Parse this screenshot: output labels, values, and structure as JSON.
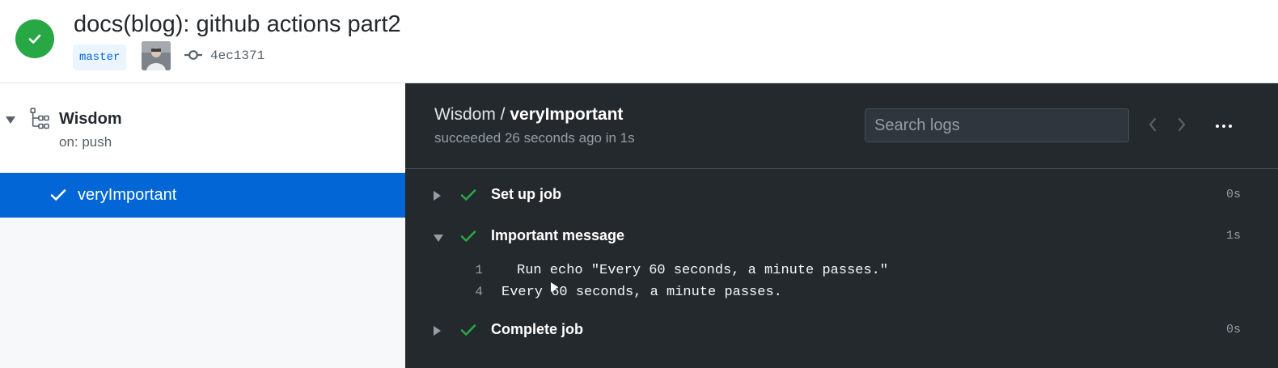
{
  "header": {
    "title": "docs(blog): github actions part2",
    "branch": "master",
    "commit_sha": "4ec1371",
    "status": "success",
    "status_color": "#28a745"
  },
  "sidebar": {
    "workflow_name": "Wisdom",
    "workflow_trigger": "on: push",
    "jobs": [
      {
        "label": "veryImportant",
        "status": "success",
        "selected": true
      }
    ],
    "selected_color": "#0366d6"
  },
  "log_panel": {
    "workflow": "Wisdom",
    "separator": " / ",
    "job": "veryImportant",
    "summary": "succeeded 26 seconds ago in 1s",
    "search_placeholder": "Search logs",
    "steps": [
      {
        "name": "Set up job",
        "duration": "0s",
        "expanded": false
      },
      {
        "name": "Important message",
        "duration": "1s",
        "expanded": true,
        "log": [
          {
            "num": "1",
            "text": "Run echo \"Every 60 seconds, a minute passes.\"",
            "collapsible": true
          },
          {
            "num": "4",
            "text": "Every 60 seconds, a minute passes.",
            "collapsible": false
          }
        ]
      },
      {
        "name": "Complete job",
        "duration": "0s",
        "expanded": false
      }
    ]
  },
  "icons": {
    "status": "check-circle-icon",
    "commit": "git-commit-icon",
    "workflow": "workflow-icon",
    "more": "kebab-horizontal-icon"
  }
}
